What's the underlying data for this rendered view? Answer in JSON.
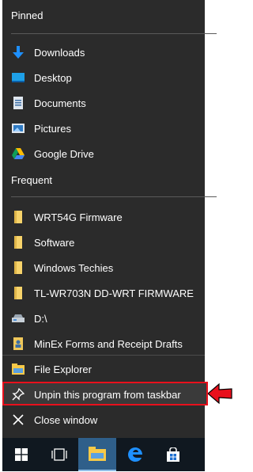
{
  "sections": {
    "pinned": "Pinned",
    "frequent": "Frequent"
  },
  "pinned_items": [
    {
      "label": "Downloads",
      "icon": "download-arrow-icon"
    },
    {
      "label": "Desktop",
      "icon": "desktop-icon"
    },
    {
      "label": "Documents",
      "icon": "documents-icon"
    },
    {
      "label": "Pictures",
      "icon": "pictures-icon"
    },
    {
      "label": "Google Drive",
      "icon": "google-drive-icon"
    }
  ],
  "frequent_items": [
    {
      "label": "WRT54G Firmware",
      "icon": "folder-icon"
    },
    {
      "label": "Software",
      "icon": "folder-icon"
    },
    {
      "label": "Windows Techies",
      "icon": "folder-icon"
    },
    {
      "label": "TL-WR703N DD-WRT FIRMWARE",
      "icon": "folder-icon"
    },
    {
      "label": "D:\\",
      "icon": "drive-icon"
    },
    {
      "label": "MinEx Forms and Receipt Drafts",
      "icon": "user-folder-icon"
    }
  ],
  "actions": {
    "file_explorer": "File Explorer",
    "unpin": "Unpin this program from taskbar",
    "close": "Close window"
  },
  "colors": {
    "panel_bg": "#2b2b2b",
    "highlight_border": "#e8101c",
    "taskbar_bg": "#101820",
    "accent_blue": "#1e90ff"
  }
}
